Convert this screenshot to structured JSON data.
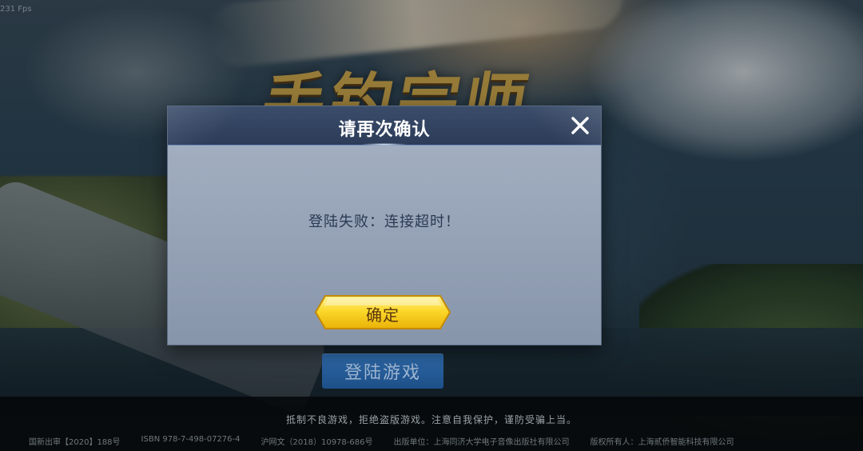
{
  "status": {
    "fps_text": "231 Fps"
  },
  "background": {
    "logo_text": "手钓宗师"
  },
  "main": {
    "login_button_label": "登陆游戏"
  },
  "footer": {
    "notice": "抵制不良游戏，拒绝盗版游戏。注意自我保护，谨防受骗上当。",
    "legal": [
      "国新出审【2020】188号",
      "ISBN 978-7-498-07276-4",
      "沪网文（2018）10978-686号",
      "出版单位：上海同济大学电子音像出版社有限公司",
      "版权所有人：上海贰侨智能科技有限公司"
    ]
  },
  "dialog": {
    "title": "请再次确认",
    "message": "登陆失败：连接超时！",
    "confirm_label": "确定",
    "close_icon": "close-icon"
  },
  "colors": {
    "dialog_header": "#2c3c59",
    "dialog_body": "#8795ab",
    "confirm_button": "#f7c614",
    "login_button": "#1d4f87"
  }
}
